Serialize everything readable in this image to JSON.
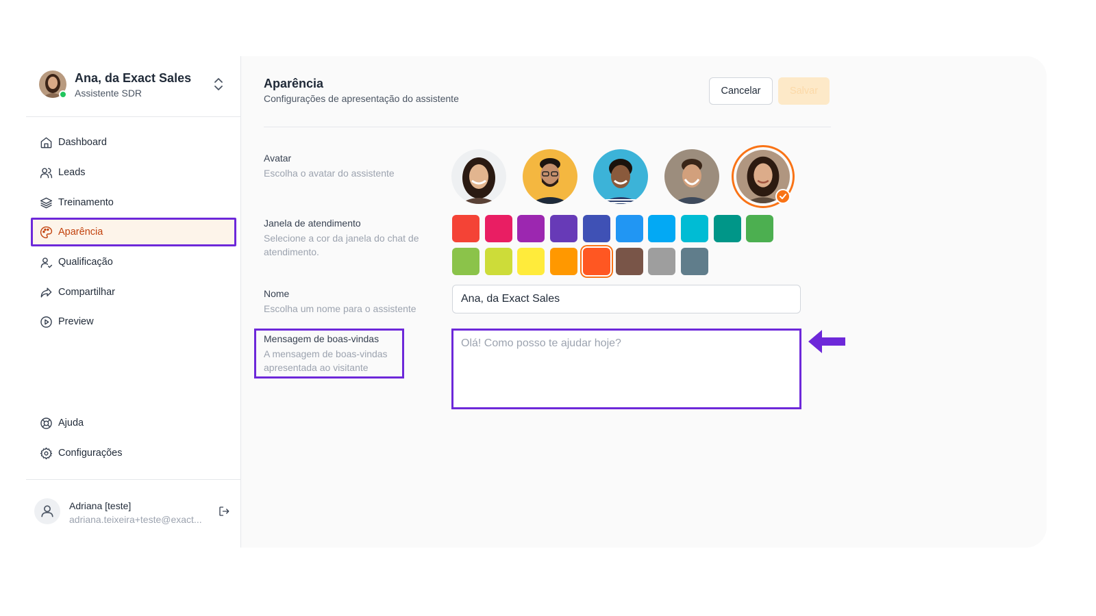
{
  "assistant": {
    "name": "Ana, da Exact Sales",
    "role": "Assistente SDR"
  },
  "sidebar": {
    "items": [
      {
        "label": "Dashboard",
        "icon": "home-icon"
      },
      {
        "label": "Leads",
        "icon": "users-icon"
      },
      {
        "label": "Treinamento",
        "icon": "layers-icon"
      },
      {
        "label": "Aparência",
        "icon": "palette-icon",
        "active": true
      },
      {
        "label": "Qualificação",
        "icon": "user-check-icon"
      },
      {
        "label": "Compartilhar",
        "icon": "share-icon"
      },
      {
        "label": "Preview",
        "icon": "play-circle-icon"
      }
    ],
    "bottom_items": [
      {
        "label": "Ajuda",
        "icon": "lifebuoy-icon"
      },
      {
        "label": "Configurações",
        "icon": "gear-icon"
      }
    ]
  },
  "user": {
    "name": "Adriana [teste]",
    "email": "adriana.teixeira+teste@exact..."
  },
  "page": {
    "title": "Aparência",
    "subtitle": "Configurações de apresentação do assistente",
    "cancel_label": "Cancelar",
    "save_label": "Salvar"
  },
  "fields": {
    "avatar": {
      "label": "Avatar",
      "help": "Escolha o avatar do assistente",
      "selected_index": 4
    },
    "janela": {
      "label": "Janela de atendimento",
      "help": "Selecione a cor da janela do chat de atendimento.",
      "colors_row1": [
        "#f44336",
        "#e91e63",
        "#9c27b0",
        "#673ab7",
        "#3f51b5",
        "#2196f3",
        "#03a9f4",
        "#00bcd4",
        "#009688",
        "#4caf50"
      ],
      "colors_row2": [
        "#8bc34a",
        "#cddc39",
        "#ffeb3b",
        "#ff9800",
        "#ff5722",
        "#795548",
        "#9e9e9e",
        "#607d8b"
      ],
      "selected_color": "#ff5722"
    },
    "nome": {
      "label": "Nome",
      "help": "Escolha um nome para o assistente",
      "value": "Ana, da Exact Sales"
    },
    "mensagem": {
      "label": "Mensagem de boas-vindas",
      "help": "A mensagem de boas-vindas apresentada ao visitante",
      "placeholder": "Olá! Como posso te ajudar hoje?",
      "value": ""
    }
  },
  "colors": {
    "accent": "#f97316",
    "highlight": "#6d28d9",
    "active_nav_bg": "#fdf4ea",
    "active_nav_text": "#c2410c"
  }
}
